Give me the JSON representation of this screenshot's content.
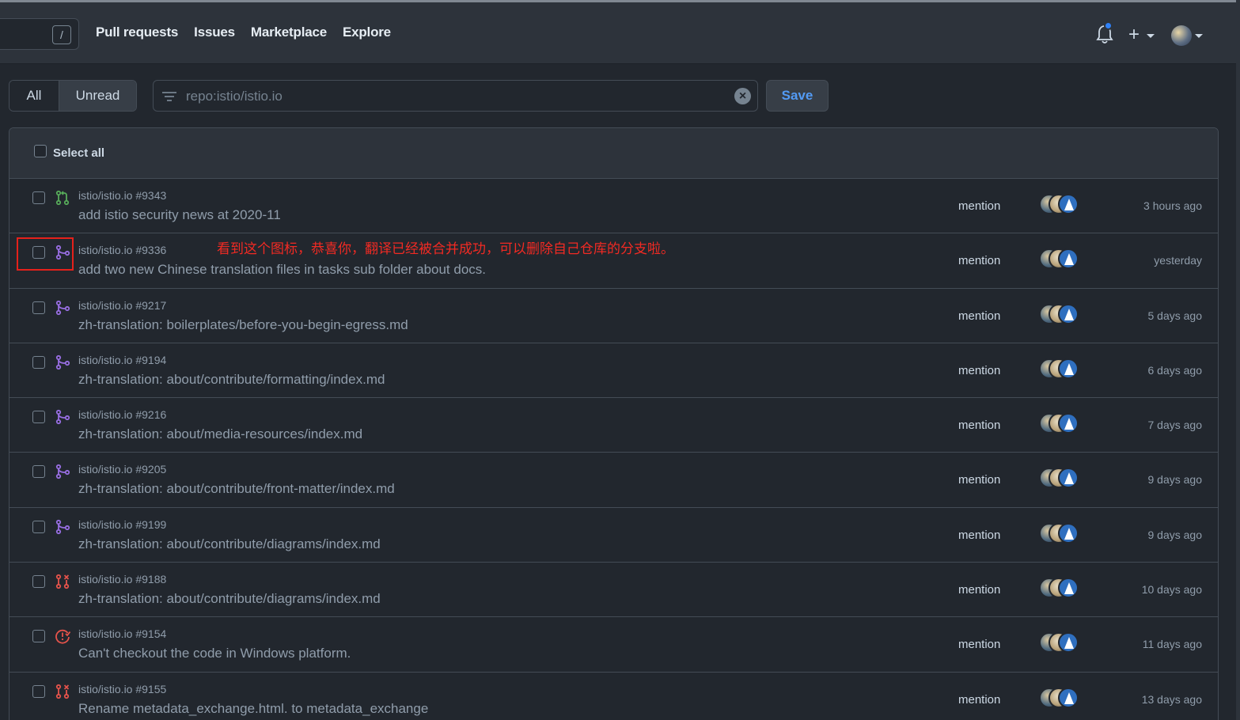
{
  "header": {
    "search_key": "/",
    "nav": [
      "Pull requests",
      "Issues",
      "Marketplace",
      "Explore"
    ],
    "create_plus": "+"
  },
  "filters": {
    "all_label": "All",
    "unread_label": "Unread",
    "query": "repo:istio/istio.io",
    "clear_symbol": "×",
    "save_label": "Save"
  },
  "list": {
    "select_all_label": "Select all",
    "annotation": "看到这个图标，恭喜你，翻译已经被合并成功，可以删除自己仓库的分支啦。",
    "rows": [
      {
        "repo": "istio/istio.io #9343",
        "title": "add istio security news at 2020-11",
        "reason": "mention",
        "time": "3 hours ago",
        "icon": "pull-request-open-icon",
        "color": "#57ab5a"
      },
      {
        "repo": "istio/istio.io #9336",
        "title": "add two new Chinese translation files in tasks sub folder about docs.",
        "reason": "mention",
        "time": "yesterday",
        "icon": "pull-request-merged-icon",
        "color": "#986ee2"
      },
      {
        "repo": "istio/istio.io #9217",
        "title": "zh-translation: boilerplates/before-you-begin-egress.md",
        "reason": "mention",
        "time": "5 days ago",
        "icon": "pull-request-merged-icon",
        "color": "#986ee2"
      },
      {
        "repo": "istio/istio.io #9194",
        "title": "zh-translation: about/contribute/formatting/index.md",
        "reason": "mention",
        "time": "6 days ago",
        "icon": "pull-request-merged-icon",
        "color": "#986ee2"
      },
      {
        "repo": "istio/istio.io #9216",
        "title": "zh-translation: about/media-resources/index.md",
        "reason": "mention",
        "time": "7 days ago",
        "icon": "pull-request-merged-icon",
        "color": "#986ee2"
      },
      {
        "repo": "istio/istio.io #9205",
        "title": "zh-translation: about/contribute/front-matter/index.md",
        "reason": "mention",
        "time": "9 days ago",
        "icon": "pull-request-merged-icon",
        "color": "#986ee2"
      },
      {
        "repo": "istio/istio.io #9199",
        "title": "zh-translation: about/contribute/diagrams/index.md",
        "reason": "mention",
        "time": "9 days ago",
        "icon": "pull-request-merged-icon",
        "color": "#986ee2"
      },
      {
        "repo": "istio/istio.io #9188",
        "title": "zh-translation: about/contribute/diagrams/index.md",
        "reason": "mention",
        "time": "10 days ago",
        "icon": "pull-request-closed-icon",
        "color": "#e5534b"
      },
      {
        "repo": "istio/istio.io #9154",
        "title": "Can't checkout the code in Windows platform.",
        "reason": "mention",
        "time": "11 days ago",
        "icon": "issue-closed-icon",
        "color": "#e5534b"
      },
      {
        "repo": "istio/istio.io #9155",
        "title": "Rename metadata_exchange.html. to metadata_exchange",
        "reason": "mention",
        "time": "13 days ago",
        "icon": "pull-request-closed-icon",
        "color": "#e5534b"
      }
    ]
  },
  "colors": {
    "bg": "#22272e",
    "header_bg": "#2d333b",
    "link_blue": "#539bf5",
    "annotation_red": "#e5211b"
  }
}
